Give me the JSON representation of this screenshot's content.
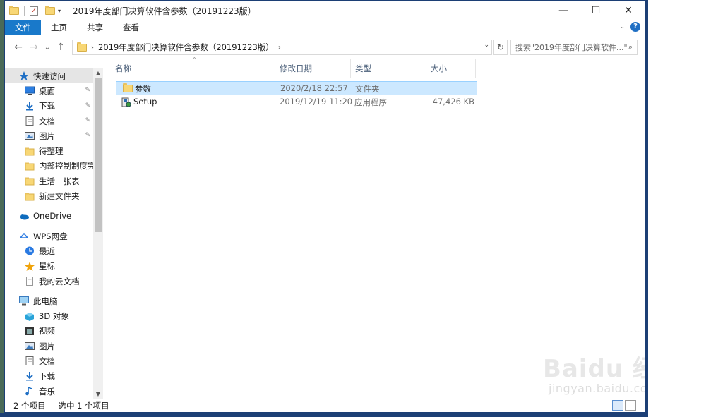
{
  "window": {
    "title": "2019年度部门决算软件含参数（20191223版）",
    "controls": {
      "minimize": "—",
      "maximize": "☐",
      "close": "✕"
    }
  },
  "ribbon": {
    "tabs": [
      "文件",
      "主页",
      "共享",
      "查看"
    ],
    "help": "?"
  },
  "navbar": {
    "back": "←",
    "forward": "→",
    "recent": "⌄",
    "up": "↑",
    "address": "2019年度部门决算软件含参数（20191223版）",
    "refresh": "↻",
    "search_placeholder": "搜索\"2019年度部门决算软件...\""
  },
  "sidebar": {
    "quick_access": "快速访问",
    "quick_items": [
      {
        "label": "桌面",
        "icon": "desktop-icon",
        "pinned": true
      },
      {
        "label": "下载",
        "icon": "download-icon",
        "pinned": true
      },
      {
        "label": "文档",
        "icon": "document-icon",
        "pinned": true
      },
      {
        "label": "图片",
        "icon": "picture-icon",
        "pinned": true
      },
      {
        "label": "待整理",
        "icon": "folder-icon",
        "pinned": false
      },
      {
        "label": "内部控制制度完",
        "icon": "folder-icon",
        "pinned": false
      },
      {
        "label": "生活一张表",
        "icon": "folder-icon",
        "pinned": false
      },
      {
        "label": "新建文件夹",
        "icon": "folder-icon",
        "pinned": false
      }
    ],
    "onedrive": "OneDrive",
    "wps": "WPS网盘",
    "wps_items": [
      {
        "label": "最近",
        "icon": "clock-icon"
      },
      {
        "label": "星标",
        "icon": "star-icon"
      },
      {
        "label": "我的云文档",
        "icon": "cloud-doc-icon"
      }
    ],
    "this_pc": "此电脑",
    "pc_items": [
      {
        "label": "3D 对象",
        "icon": "cube-3d-icon"
      },
      {
        "label": "视频",
        "icon": "video-icon"
      },
      {
        "label": "图片",
        "icon": "picture-icon"
      },
      {
        "label": "文档",
        "icon": "document-icon"
      },
      {
        "label": "下载",
        "icon": "download-icon"
      },
      {
        "label": "音乐",
        "icon": "music-icon"
      }
    ]
  },
  "columns": {
    "name": "名称",
    "date": "修改日期",
    "type": "类型",
    "size": "大小"
  },
  "files": [
    {
      "name": "参数",
      "date": "2020/2/18 22:57",
      "type": "文件夹",
      "size": "",
      "icon": "folder-icon",
      "selected": true
    },
    {
      "name": "Setup",
      "date": "2019/12/19 11:20",
      "type": "应用程序",
      "size": "47,426 KB",
      "icon": "setup-app-icon",
      "selected": false
    }
  ],
  "status": {
    "count": "2 个项目",
    "selection": "选中 1 个项目"
  },
  "watermark": {
    "text": "Baidu 经验",
    "sub": "jingyan.baidu.com"
  },
  "colors": {
    "accent": "#1979ca",
    "selection": "#cce8ff",
    "frame": "#1c3f75"
  }
}
